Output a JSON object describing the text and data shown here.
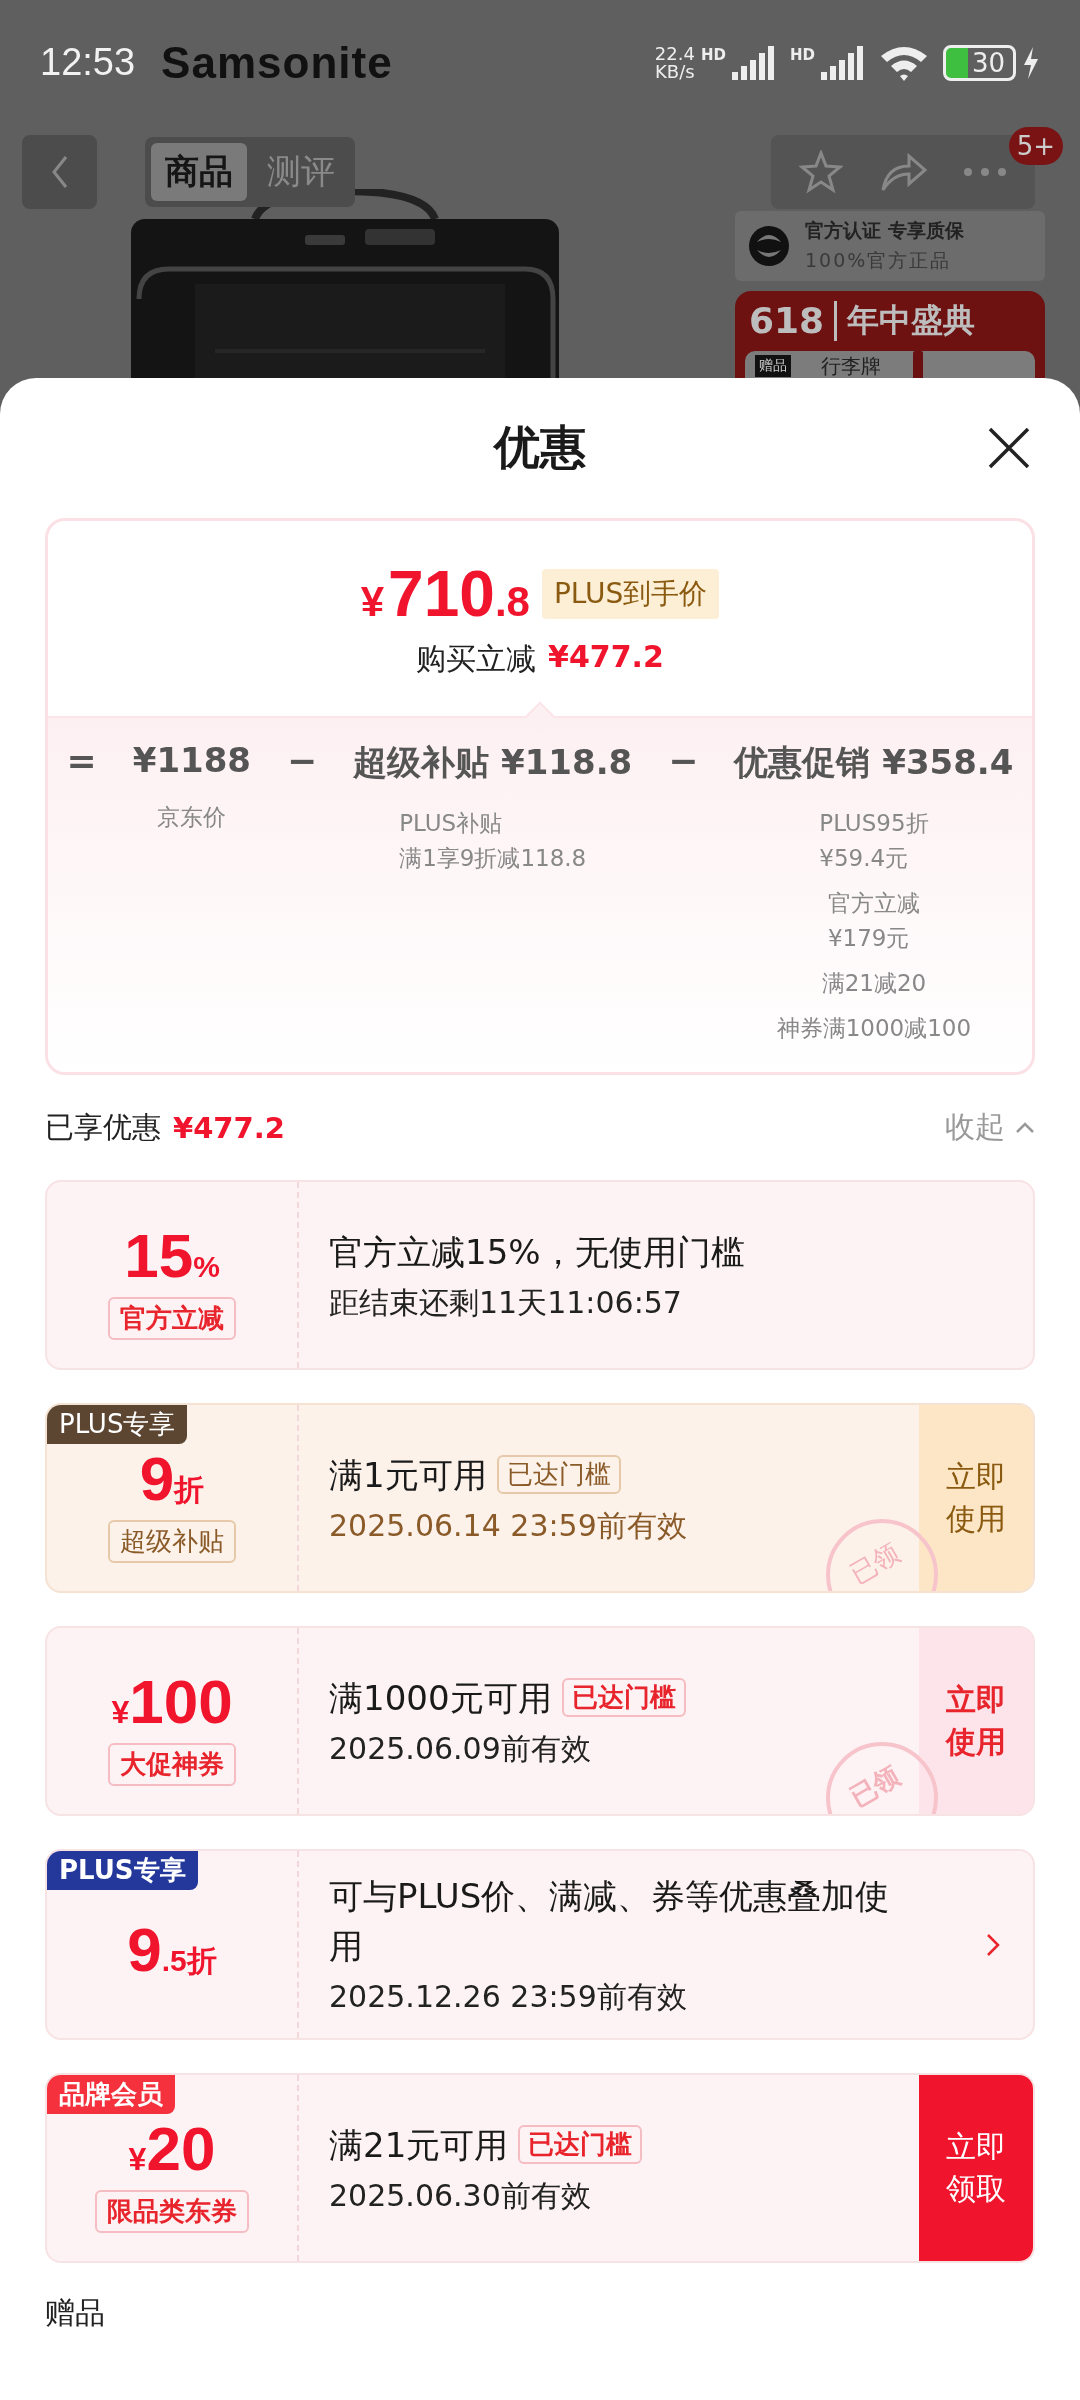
{
  "status_bar": {
    "time": "12:53",
    "logo": "Samsonite",
    "net_speed": "22.4",
    "net_unit": "KB/s",
    "sim_labels": [
      "HD",
      "HD"
    ],
    "battery": "30",
    "charging": true
  },
  "nav": {
    "tabs": [
      {
        "label": "商品",
        "selected": true
      },
      {
        "label": "测评",
        "selected": false
      }
    ],
    "badge": "5+"
  },
  "promo": {
    "cert_title": "官方认证 专享质保",
    "cert_sub": "100%官方正品",
    "event_number": "618",
    "event_title": "年中盛典",
    "gift_tag": "赠品",
    "gift_name": "行李牌"
  },
  "sheet": {
    "title": "优惠",
    "summary": {
      "currency": "¥",
      "price_main": "710",
      "price_decimal": ".8",
      "price_badge": "PLUS到手价",
      "saving_label": "购买立减",
      "saving_amount": "¥477.2",
      "equation": [
        {
          "kind": "sign",
          "text": "="
        },
        {
          "kind": "term",
          "amount": "¥1188",
          "notes": [
            [
              "京东价"
            ]
          ]
        },
        {
          "kind": "sign",
          "text": "−"
        },
        {
          "kind": "term",
          "label": "超级补贴",
          "amount": "¥118.8",
          "notes": [
            [
              "PLUS补贴",
              "满1享9折减118.8"
            ]
          ]
        },
        {
          "kind": "sign",
          "text": "−"
        },
        {
          "kind": "term",
          "label": "优惠促销",
          "amount": "¥358.4",
          "notes": [
            [
              "PLUS95折",
              "¥59.4元"
            ],
            [
              "官方立减",
              "¥179元"
            ],
            [
              "满21减20"
            ],
            [
              "神券满1000减100"
            ]
          ]
        }
      ]
    },
    "enjoyed": {
      "label": "已享优惠",
      "amount": "¥477.2",
      "toggle": "收起"
    },
    "coupons": [
      {
        "kind": "red",
        "amount": "15",
        "suffix": "%",
        "label": "官方立减",
        "title": "官方立减15%，无使用门槛",
        "validity": "距结束还剩11天11:06:57",
        "action": {
          "kind": "none"
        }
      },
      {
        "kind": "gold",
        "tag": {
          "text": "PLUS专享",
          "color": "#5c4632"
        },
        "amount": "9",
        "suffix": "折",
        "label": "超级补贴",
        "title": "满1元可用",
        "threshold": "已达门槛",
        "validity": "2025.06.14 23:59前有效",
        "action": {
          "kind": "use",
          "text": "立即使用"
        },
        "stamp": "已领"
      },
      {
        "kind": "red",
        "prefix": "¥",
        "amount": "100",
        "label": "大促神券",
        "title": "满1000元可用",
        "threshold": "已达门槛",
        "validity": "2025.06.09前有效",
        "action": {
          "kind": "use",
          "text": "立即使用"
        },
        "stamp": "已领"
      },
      {
        "kind": "red",
        "tag": {
          "text": "PLUS专享",
          "color": "#24389c"
        },
        "amount": "9",
        "suffix": ".5折",
        "title": "可与PLUS价、满减、券等优惠叠加使用",
        "validity": "2025.12.26 23:59前有效",
        "action": {
          "kind": "arrow"
        }
      },
      {
        "kind": "red",
        "tag": {
          "text": "品牌会员",
          "color": "#f5313d"
        },
        "prefix": "¥",
        "amount": "20",
        "label": "限品类东券",
        "title": "满21元可用",
        "threshold": "已达门槛",
        "validity": "2025.06.30前有效",
        "action": {
          "kind": "claim",
          "text": "立即领取"
        }
      }
    ],
    "gifts_heading": "赠品"
  }
}
